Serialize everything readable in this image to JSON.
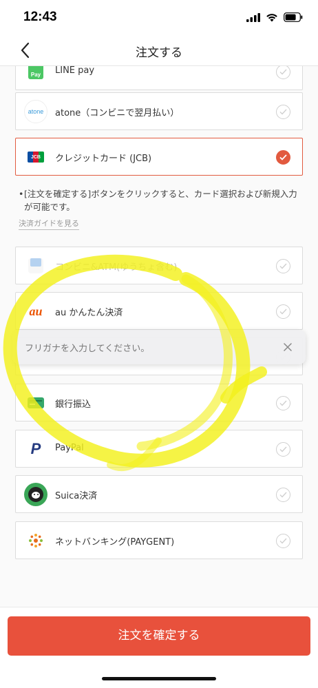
{
  "status_bar": {
    "time": "12:43"
  },
  "nav": {
    "title": "注文する"
  },
  "payment_options": [
    {
      "label": "LINE pay",
      "selected": false
    },
    {
      "label": "atone（コンビニで翌月払い）",
      "logo_text": "atone",
      "selected": false
    },
    {
      "label": "クレジットカード (JCB)",
      "logo_text": "JCB",
      "selected": true
    },
    {
      "label": "コンビニ&ATM(ゆうちょ含む)",
      "selected": false,
      "dimmed": true
    },
    {
      "label": "au かんたん決済",
      "logo_text": "au",
      "selected": false
    },
    {
      "label": "",
      "selected": false
    },
    {
      "label": "銀行振込",
      "selected": false
    },
    {
      "label": "PayPal",
      "selected": false
    },
    {
      "label": "Suica決済",
      "selected": false
    },
    {
      "label": "ネットバンキング(PAYGENT)",
      "selected": false
    }
  ],
  "note": {
    "bullet": "•",
    "text": "[注文を確定する]ボタンをクリックすると、カード選択および新規入力が可能です。",
    "guide_link": "決済ガイドを見る"
  },
  "toast": {
    "text": "フリガナを入力してください。"
  },
  "footer": {
    "confirm_label": "注文を確定する"
  },
  "colors": {
    "accent": "#e8513c",
    "highlighter": "#f3f01c"
  }
}
